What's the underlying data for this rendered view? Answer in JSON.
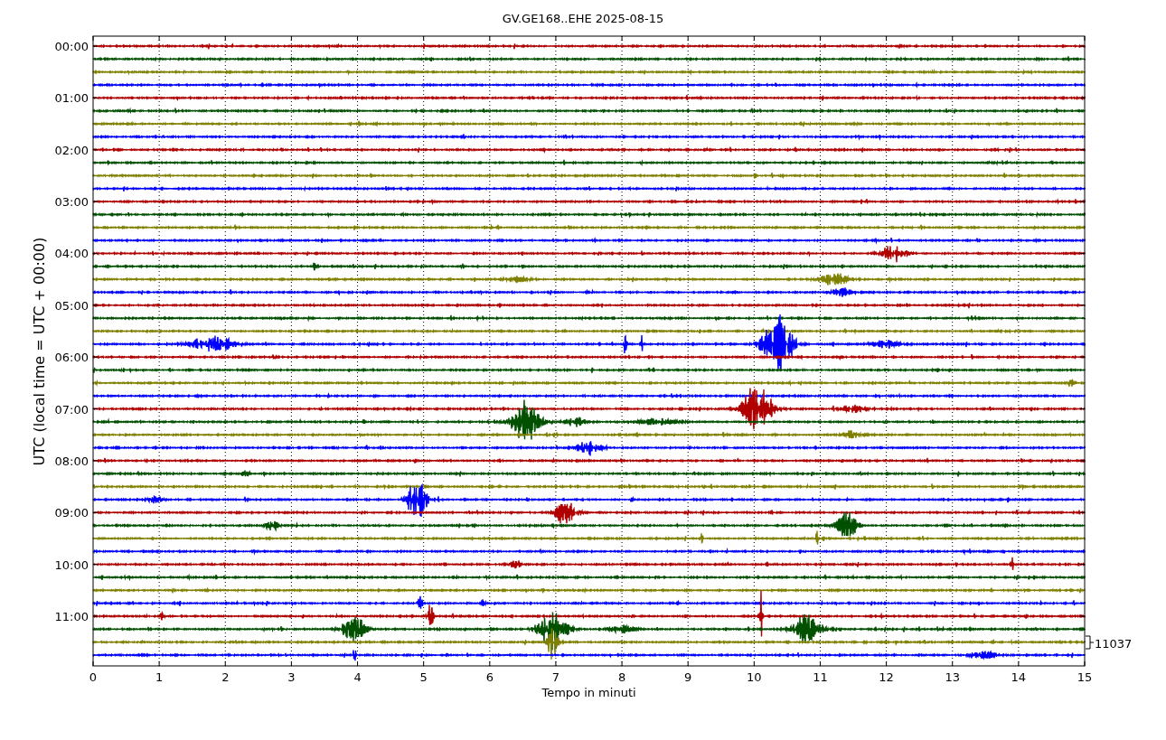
{
  "plot": {
    "title": "GV.GE168..EHE 2025-08-15",
    "xlabel": "Tempo in minuti",
    "ylabel": "UTC (local time = UTC + 00:00)",
    "xticks": [
      "0",
      "1",
      "2",
      "3",
      "4",
      "5",
      "6",
      "7",
      "8",
      "9",
      "10",
      "11",
      "12",
      "13",
      "14",
      "15"
    ],
    "yticks": [
      "00:00",
      "01:00",
      "02:00",
      "03:00",
      "04:00",
      "05:00",
      "06:00",
      "07:00",
      "08:00",
      "09:00",
      "10:00",
      "11:00"
    ],
    "scale_label": "11037",
    "traces": [
      {
        "color": "#b00000"
      },
      {
        "color": "#005000"
      },
      {
        "color": "#808000"
      },
      {
        "color": "#0000ff"
      },
      {
        "color": "#b00000"
      },
      {
        "color": "#005000"
      },
      {
        "color": "#808000"
      },
      {
        "color": "#0000ff"
      },
      {
        "color": "#b00000"
      },
      {
        "color": "#005000"
      },
      {
        "color": "#808000"
      },
      {
        "color": "#0000ff"
      },
      {
        "color": "#b00000"
      },
      {
        "color": "#005000"
      },
      {
        "color": "#808000"
      },
      {
        "color": "#0000ff"
      },
      {
        "color": "#b00000"
      },
      {
        "color": "#005000"
      },
      {
        "color": "#808000"
      },
      {
        "color": "#0000ff"
      },
      {
        "color": "#b00000"
      },
      {
        "color": "#005000"
      },
      {
        "color": "#808000"
      },
      {
        "color": "#0000ff"
      },
      {
        "color": "#b00000"
      },
      {
        "color": "#005000"
      },
      {
        "color": "#808000"
      },
      {
        "color": "#0000ff"
      },
      {
        "color": "#b00000"
      },
      {
        "color": "#005000"
      },
      {
        "color": "#808000"
      },
      {
        "color": "#0000ff"
      },
      {
        "color": "#b00000"
      },
      {
        "color": "#005000"
      },
      {
        "color": "#808000"
      },
      {
        "color": "#0000ff"
      },
      {
        "color": "#b00000"
      },
      {
        "color": "#005000"
      },
      {
        "color": "#808000"
      },
      {
        "color": "#0000ff"
      },
      {
        "color": "#b00000"
      },
      {
        "color": "#005000"
      },
      {
        "color": "#808000"
      },
      {
        "color": "#0000ff"
      },
      {
        "color": "#b00000"
      },
      {
        "color": "#005000"
      },
      {
        "color": "#808000"
      },
      {
        "color": "#0000ff"
      }
    ]
  }
}
